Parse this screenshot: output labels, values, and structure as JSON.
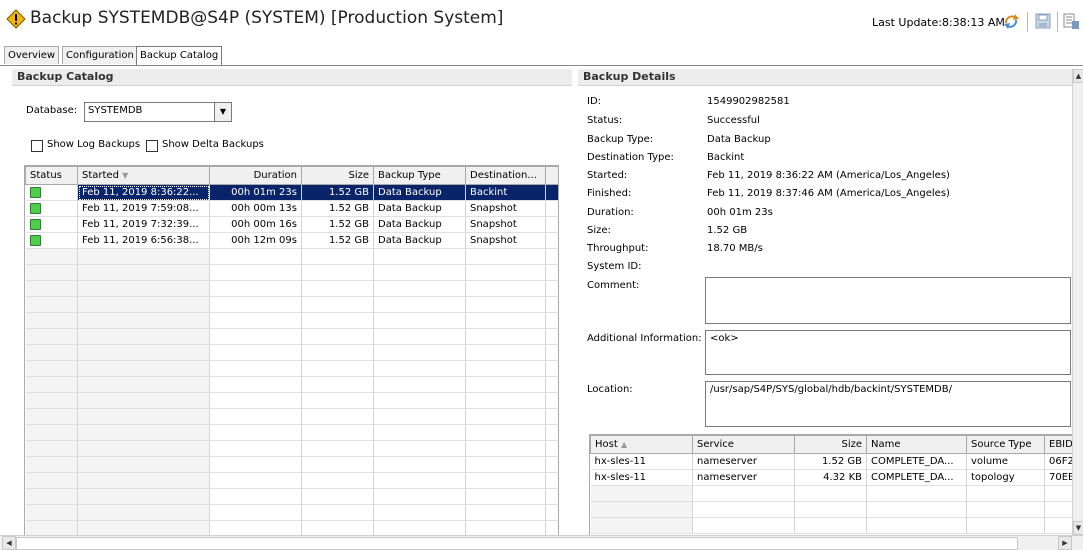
{
  "header": {
    "title": "Backup SYSTEMDB@S4P (SYSTEM) [Production System]",
    "last_update": "Last Update:8:38:13 AM"
  },
  "tabs": [
    "Overview",
    "Configuration",
    "Backup Catalog"
  ],
  "catalog": {
    "panel_title": "Backup Catalog",
    "database_label": "Database:",
    "database_value": "SYSTEMDB",
    "show_log_backups": "Show Log Backups",
    "show_delta_backups": "Show Delta Backups",
    "columns": [
      "Status",
      "Started",
      "Duration",
      "Size",
      "Backup Type",
      "Destination..."
    ],
    "rows": [
      {
        "started": "Feb 11, 2019 8:36:22...",
        "duration": "00h 01m 23s",
        "size": "1.52 GB",
        "type": "Data Backup",
        "dest": "Backint"
      },
      {
        "started": "Feb 11, 2019 7:59:08...",
        "duration": "00h 00m 13s",
        "size": "1.52 GB",
        "type": "Data Backup",
        "dest": "Snapshot"
      },
      {
        "started": "Feb 11, 2019 7:32:39...",
        "duration": "00h 00m 16s",
        "size": "1.52 GB",
        "type": "Data Backup",
        "dest": "Snapshot"
      },
      {
        "started": "Feb 11, 2019 6:56:38...",
        "duration": "00h 12m 09s",
        "size": "1.52 GB",
        "type": "Data Backup",
        "dest": "Snapshot"
      }
    ]
  },
  "details": {
    "panel_title": "Backup Details",
    "fields": [
      {
        "label": "ID:",
        "value": "1549902982581"
      },
      {
        "label": "Status:",
        "value": "Successful"
      },
      {
        "label": "Backup Type:",
        "value": "Data Backup"
      },
      {
        "label": "Destination Type:",
        "value": "Backint"
      },
      {
        "label": "Started:",
        "value": "Feb 11, 2019 8:36:22 AM (America/Los_Angeles)"
      },
      {
        "label": "Finished:",
        "value": "Feb 11, 2019 8:37:46 AM (America/Los_Angeles)"
      },
      {
        "label": "Duration:",
        "value": "00h 01m 23s"
      },
      {
        "label": "Size:",
        "value": "1.52 GB"
      },
      {
        "label": "Throughput:",
        "value": "18.70 MB/s"
      },
      {
        "label": "System ID:",
        "value": ""
      }
    ],
    "comment_label": "Comment:",
    "comment_value": "",
    "additional_label": "Additional Information:",
    "additional_value": "<ok>",
    "location_label": "Location:",
    "location_value": "/usr/sap/S4P/SYS/global/hdb/backint/SYSTEMDB/",
    "file_columns": [
      "Host",
      "Service",
      "Size",
      "Name",
      "Source Type",
      "EBID"
    ],
    "files": [
      {
        "host": "hx-sles-11",
        "service": "nameserver",
        "size": "1.52 GB",
        "name": "COMPLETE_DA...",
        "source": "volume",
        "ebid": "06F2"
      },
      {
        "host": "hx-sles-11",
        "service": "nameserver",
        "size": "4.32 KB",
        "name": "COMPLETE_DA...",
        "source": "topology",
        "ebid": "70EB"
      }
    ]
  },
  "colors": {
    "selection": "#0a246a",
    "status_ok": "#4ccd4c",
    "warning_icon": "#f2b705"
  },
  "icons": [
    "warning-diamond-icon",
    "refresh-icon",
    "save-icon",
    "export-icon",
    "sort-desc-icon",
    "sort-asc-icon",
    "dropdown-arrow-icon"
  ]
}
